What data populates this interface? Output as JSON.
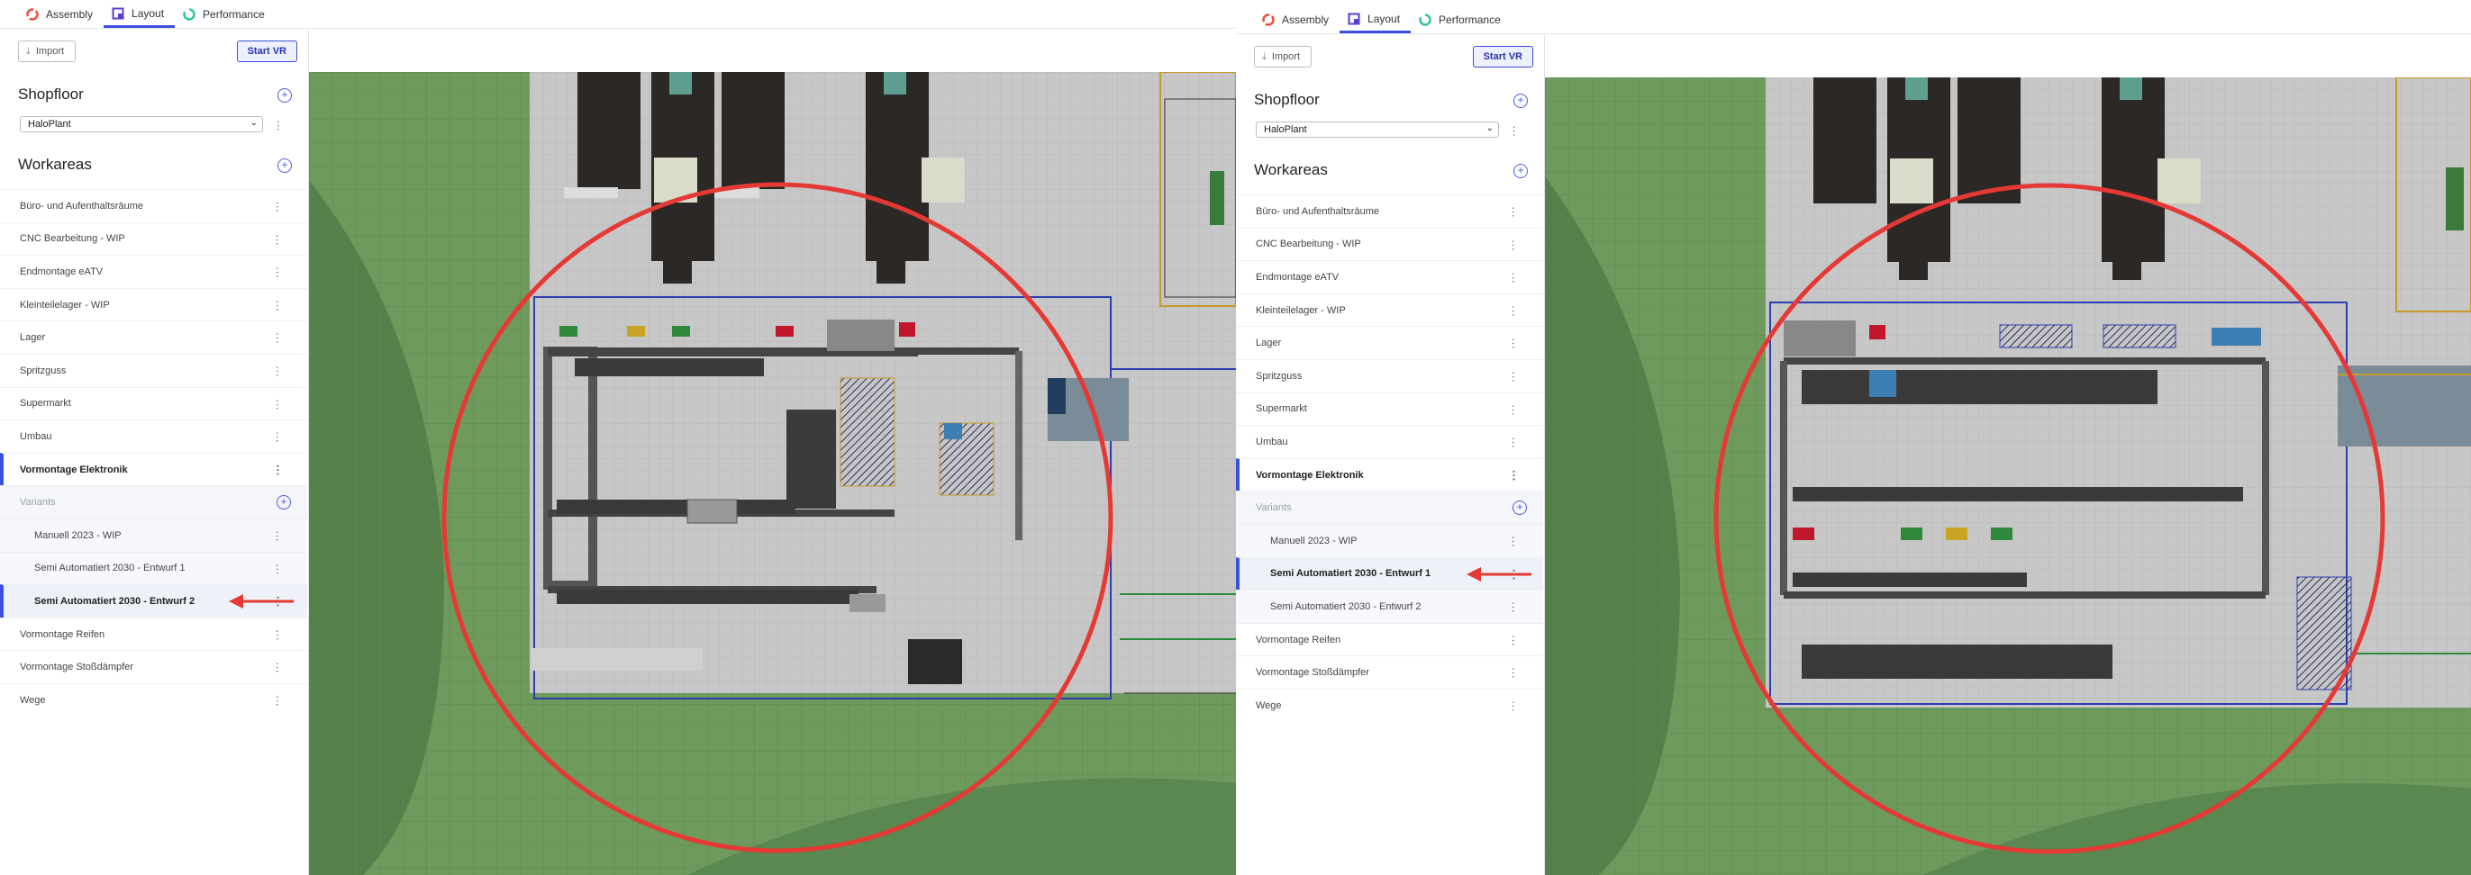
{
  "tabs": [
    {
      "label": "Assembly",
      "icon": "assembly-icon",
      "color": "#e8503a"
    },
    {
      "label": "Layout",
      "icon": "layout-icon",
      "color": "#5a3fd6"
    },
    {
      "label": "Performance",
      "icon": "performance-icon",
      "color": "#2ec3a0"
    }
  ],
  "toolbar": {
    "import_label": "Import",
    "vr_label": "Start VR"
  },
  "shopfloor": {
    "title": "Shopfloor",
    "selected": "HaloPlant"
  },
  "workareas": {
    "title": "Workareas"
  },
  "items": [
    "Büro- und Aufenthaltsräume",
    "CNC Bearbeitung - WIP",
    "Endmontage eATV",
    "Kleinteilelager - WIP",
    "Lager",
    "Spritzguss",
    "Supermarkt",
    "Umbau",
    "Vormontage Elektronik"
  ],
  "variants": {
    "title": "Variants",
    "items": [
      "Manuell 2023 - WIP",
      "Semi Automatiert 2030 - Entwurf 1",
      "Semi Automatiert 2030 - Entwurf 2"
    ]
  },
  "items_after": [
    "Vormontage Reifen",
    "Vormontage Stoßdämpfer",
    "Wege"
  ],
  "panels": [
    {
      "selected_variant_index": 2
    },
    {
      "selected_variant_index": 1
    }
  ],
  "colors": {
    "accent": "#3b4fe0",
    "annotation": "#e53935",
    "grass": "#6e9a5e",
    "floor": "#c7c7c7"
  }
}
